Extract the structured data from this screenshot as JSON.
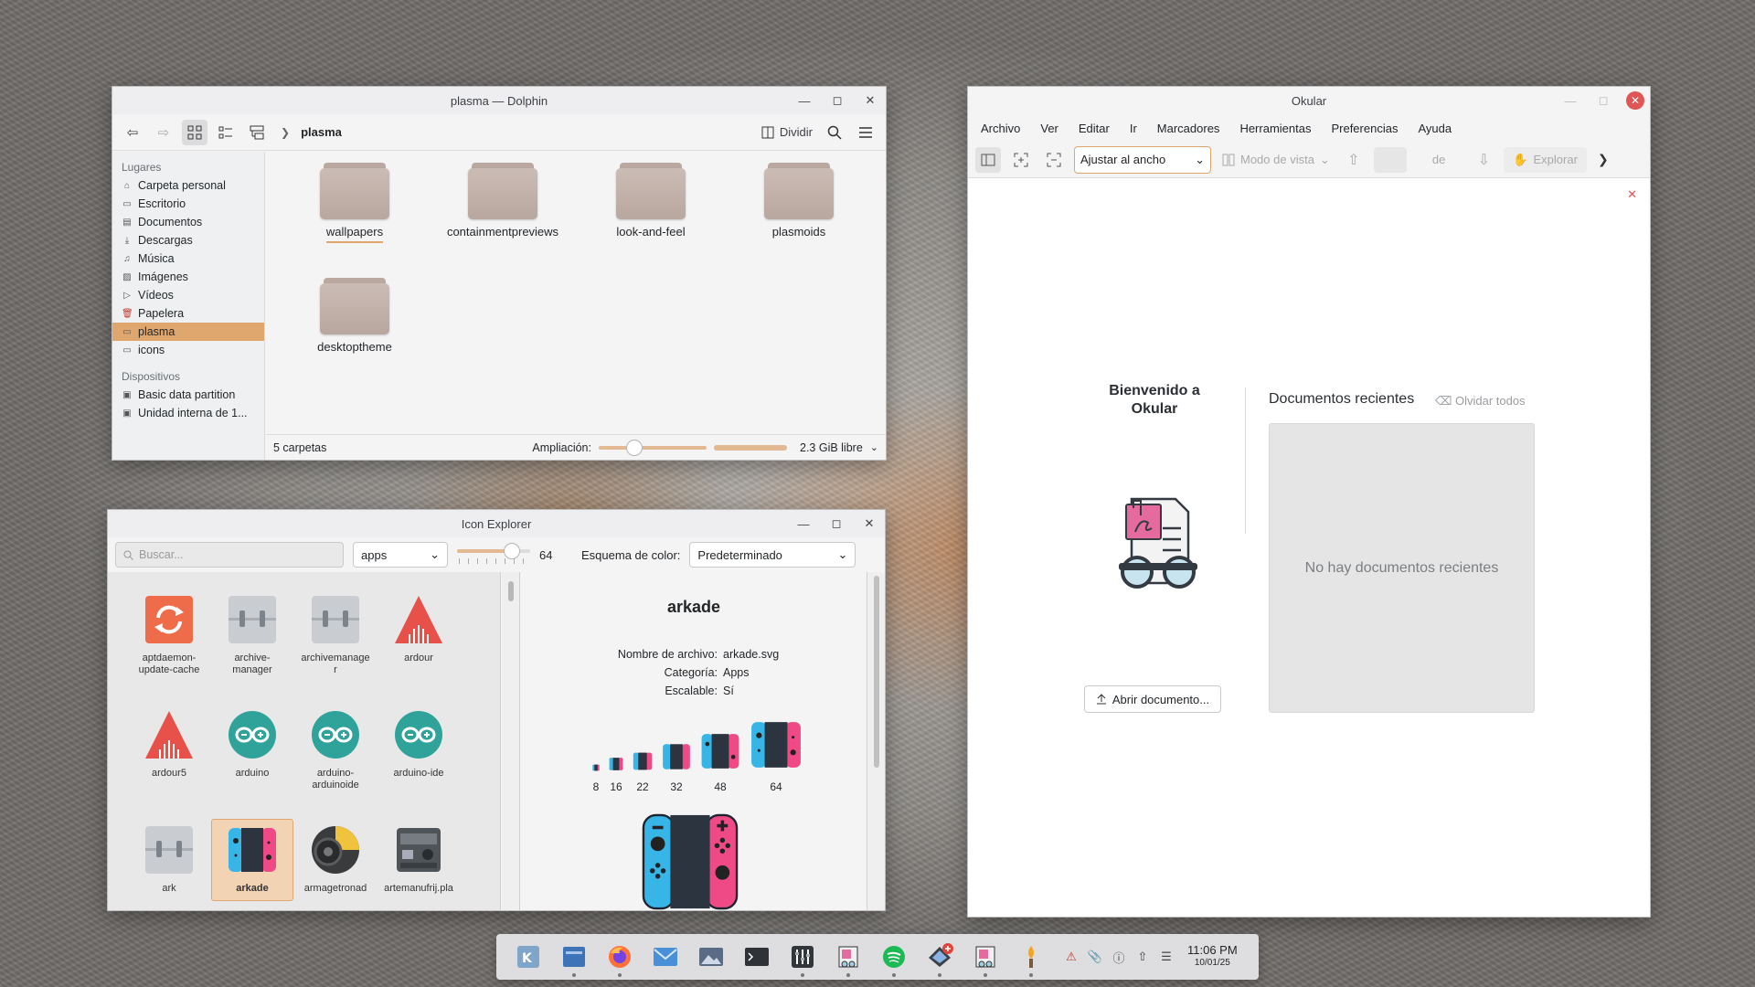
{
  "dolphin": {
    "title": "plasma — Dolphin",
    "breadcrumb": "plasma",
    "split_label": "Dividir",
    "sidebar": {
      "places_heading": "Lugares",
      "places": [
        {
          "label": "Carpeta personal",
          "icon": "home-icon"
        },
        {
          "label": "Escritorio",
          "icon": "desktop-icon"
        },
        {
          "label": "Documentos",
          "icon": "document-icon"
        },
        {
          "label": "Descargas",
          "icon": "download-icon"
        },
        {
          "label": "Música",
          "icon": "music-icon"
        },
        {
          "label": "Imágenes",
          "icon": "image-icon"
        },
        {
          "label": "Vídeos",
          "icon": "video-icon"
        },
        {
          "label": "Papelera",
          "icon": "trash-icon"
        },
        {
          "label": "plasma",
          "icon": "folder-icon",
          "selected": true
        },
        {
          "label": "icons",
          "icon": "folder-icon"
        }
      ],
      "devices_heading": "Dispositivos",
      "devices": [
        {
          "label": "Basic data partition",
          "icon": "drive-icon"
        },
        {
          "label": "Unidad interna de 1...",
          "icon": "drive-icon"
        }
      ]
    },
    "folders": [
      "wallpapers",
      "containmentpreviews",
      "look-and-feel",
      "plasmoids",
      "desktoptheme"
    ],
    "status": {
      "count": "5 carpetas",
      "zoom_label": "Ampliación:",
      "free_space": "2.3 GiB libre",
      "zoom_fraction": 0.3,
      "space_fraction": 1.0
    }
  },
  "iconexplorer": {
    "title": "Icon Explorer",
    "search_placeholder": "Buscar...",
    "category": "apps",
    "size_value": "64",
    "size_fraction": 0.75,
    "scheme_label": "Esquema de color:",
    "scheme_value": "Predeterminado",
    "icons": [
      {
        "name": "aptdaemon-update-cache",
        "label": "aptdaemon-\nupdate-cache"
      },
      {
        "name": "archive-manager",
        "label": "archive-\nmanager"
      },
      {
        "name": "archivemanager",
        "label": "archivemanage\nr"
      },
      {
        "name": "ardour",
        "label": "ardour"
      },
      {
        "name": "ardour5",
        "label": "ardour5"
      },
      {
        "name": "arduino",
        "label": "arduino"
      },
      {
        "name": "arduino-arduinoide",
        "label": "arduino-\narduinoide"
      },
      {
        "name": "arduino-ide",
        "label": "arduino-ide"
      },
      {
        "name": "ark",
        "label": "ark"
      },
      {
        "name": "arkade",
        "label": "arkade"
      },
      {
        "name": "armagetronad",
        "label": "armagetronad"
      },
      {
        "name": "artemanufrij.pla",
        "label": "artemanufrij.pla"
      }
    ],
    "detail": {
      "name": "arkade",
      "filename_label": "Nombre de archivo:",
      "filename": "arkade.svg",
      "category_label": "Categoría:",
      "category": "Apps",
      "scalable_label": "Escalable:",
      "scalable": "Sí",
      "sizes": [
        "8",
        "16",
        "22",
        "32",
        "48",
        "64"
      ]
    }
  },
  "okular": {
    "title": "Okular",
    "menu": [
      "Archivo",
      "Ver",
      "Editar",
      "Ir",
      "Marcadores",
      "Herramientas",
      "Preferencias",
      "Ayuda"
    ],
    "zoom": "Ajustar al ancho",
    "view_mode": "Modo de vista",
    "page_of": "de",
    "browse": "Explorar",
    "welcome": "Bienvenido a Okular",
    "recent_title": "Documentos recientes",
    "forget_all": "Olvidar todos",
    "no_recent": "No hay documentos recientes",
    "open_document": "Abrir documento..."
  },
  "taskbar": {
    "apps": [
      {
        "name": "kde-launcher-icon",
        "running": false
      },
      {
        "name": "file-manager-icon",
        "running": true
      },
      {
        "name": "firefox-icon",
        "running": true
      },
      {
        "name": "mail-icon",
        "running": false
      },
      {
        "name": "image-viewer-icon",
        "running": false
      },
      {
        "name": "terminal-icon",
        "running": false
      },
      {
        "name": "mixer-icon",
        "running": true
      },
      {
        "name": "document-viewer-icon",
        "running": true
      },
      {
        "name": "spotify-icon",
        "running": true
      },
      {
        "name": "discover-icon",
        "running": true,
        "badge": true
      },
      {
        "name": "okular-taskbar-icon",
        "running": true
      },
      {
        "name": "torch-icon",
        "running": true
      }
    ],
    "time": "11:06 PM",
    "date": "10/01/25"
  },
  "colors": {
    "accent": "#dfa66e",
    "selection": "#f2d3b3",
    "close_red": "#e05555",
    "joycon_blue": "#36b5e6",
    "joycon_pink": "#ef4a86"
  }
}
